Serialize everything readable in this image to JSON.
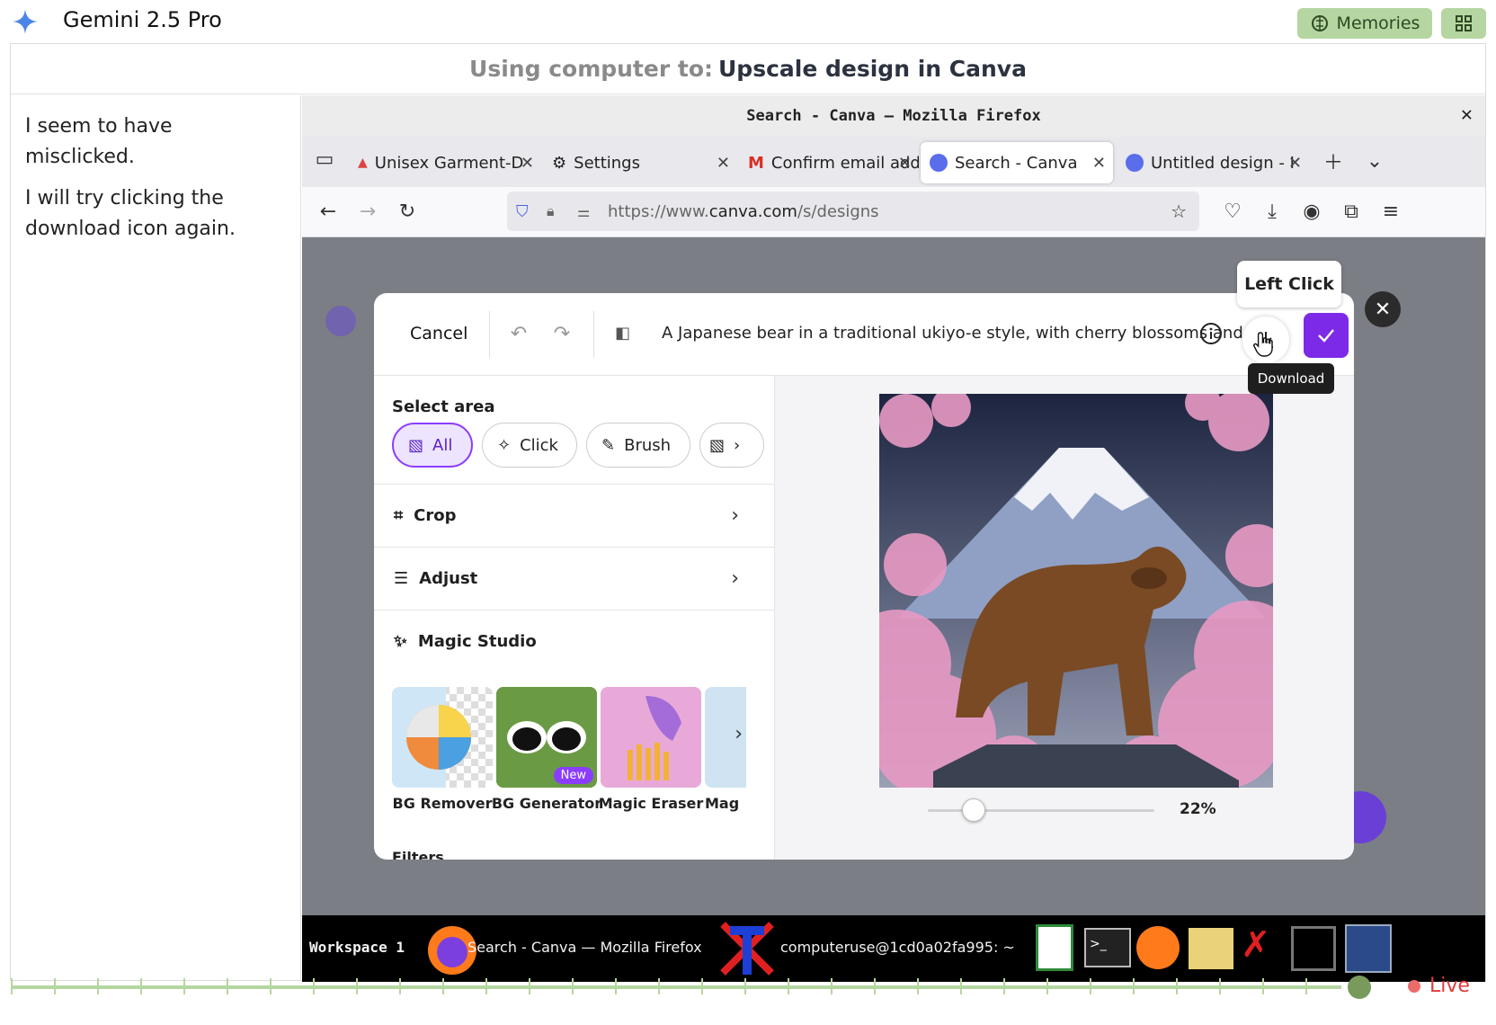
{
  "app": {
    "title": "Gemini 2.5 Pro",
    "memories_label": "Memories"
  },
  "task": {
    "prefix": "Using computer to:",
    "goal": "Upscale design in Canva"
  },
  "thoughts": [
    "I seem to have misclicked.",
    "I will try clicking the download icon again."
  ],
  "browser": {
    "window_title": "Search - Canva — Mozilla Firefox",
    "tabs": [
      {
        "label": "Unisex Garment-D",
        "icon": "canva-triangle-icon"
      },
      {
        "label": "Settings",
        "icon": "gear-icon"
      },
      {
        "label": "Confirm email add",
        "icon": "gmail-icon"
      },
      {
        "label": "Search - Canva",
        "icon": "canva-icon",
        "active": true
      },
      {
        "label": "Untitled design - I",
        "icon": "canva-icon"
      }
    ],
    "url_prefix": "https://www.",
    "url_domain": "canva.com",
    "url_path": "/s/designs"
  },
  "editor": {
    "cancel_label": "Cancel",
    "prompt": "A Japanese bear in a traditional ukiyo-e style, with cherry blossoms and ...",
    "select_area_label": "Select area",
    "select_options": [
      "All",
      "Click",
      "Brush"
    ],
    "crop_label": "Crop",
    "adjust_label": "Adjust",
    "magic_studio_label": "Magic Studio",
    "magic_tools": [
      "BG Remover",
      "BG Generator",
      "Magic Eraser",
      "Mag"
    ],
    "new_badge": "New",
    "filters_label": "Filters",
    "zoom": "22%",
    "zoom_fraction": 0.22
  },
  "tooltips": {
    "action": "Left Click",
    "download": "Download"
  },
  "taskbar": {
    "workspace": "Workspace 1",
    "firefox_item": "Search - Canva — Mozilla Firefox",
    "terminal_item": "computeruse@1cd0a02fa995: ~"
  },
  "status": {
    "live_label": "Live"
  },
  "colors": {
    "accent_green": "#b5d6a1",
    "canva_purple": "#7d2ae8",
    "live_red": "#e03a3a"
  }
}
